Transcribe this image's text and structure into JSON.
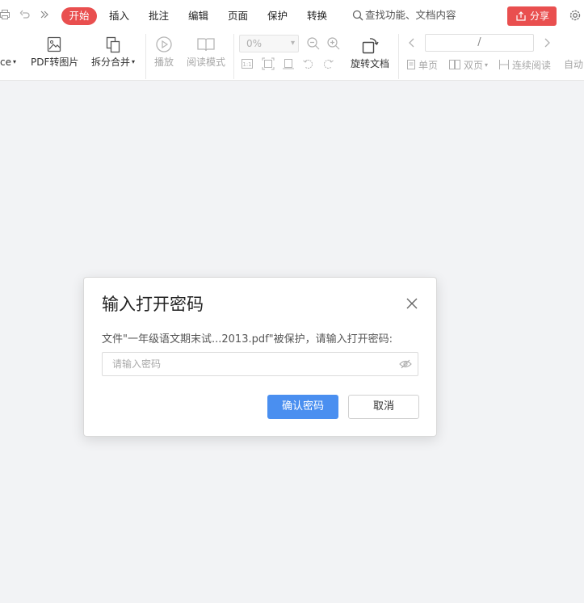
{
  "menubar": {
    "tabs": {
      "start": "开始",
      "insert": "插入",
      "annotate": "批注",
      "edit": "编辑",
      "page": "页面",
      "protect": "保护",
      "convert": "转换"
    },
    "search_placeholder": "查找功能、文档内容",
    "share_label": "分享",
    "accent_color": "#e94f4f"
  },
  "toolbar": {
    "office_partial": "ce",
    "pdf_to_image": "PDF转图片",
    "split_merge": "拆分合并",
    "play": "播放",
    "read_mode": "阅读模式",
    "zoom_value": "0%",
    "rotate_doc": "旋转文档",
    "page_indicator": "/",
    "single_page": "单页",
    "double_page": "双页",
    "continuous_read": "连续阅读",
    "auto_partial": "自动"
  },
  "dialog": {
    "title": "输入打开密码",
    "message": "文件\"一年级语文期末试...2013.pdf\"被保护，请输入打开密码:",
    "password_placeholder": "请输入密码",
    "password_value": "",
    "confirm_label": "确认密码",
    "cancel_label": "取消",
    "confirm_color": "#4a8ff0"
  }
}
